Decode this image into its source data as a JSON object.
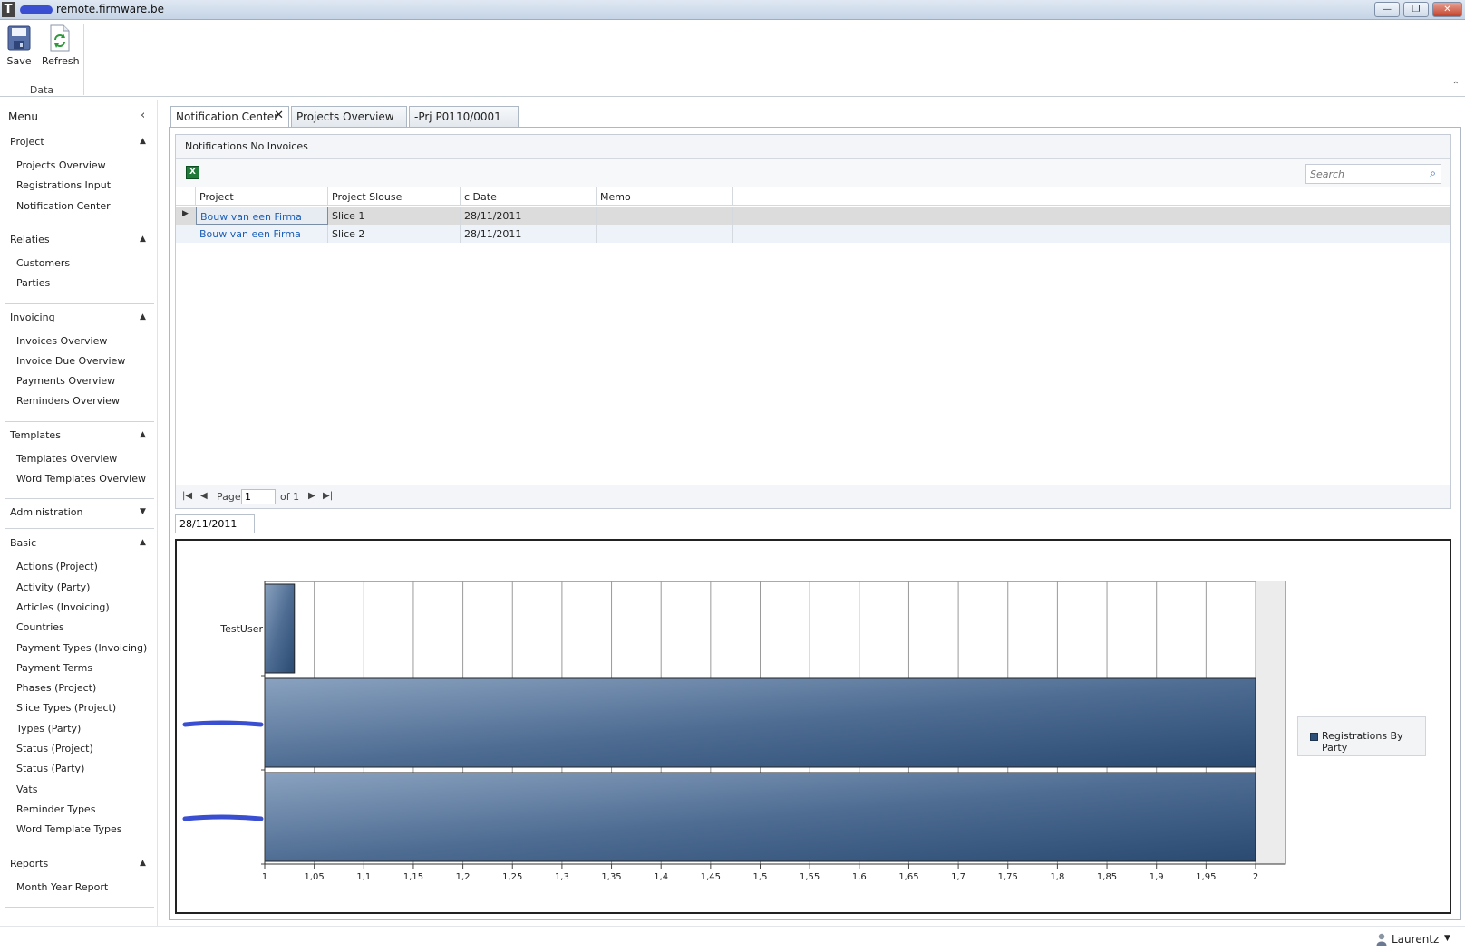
{
  "window": {
    "title": "remote.firmware.be",
    "minimize": "—",
    "maximize": "❐",
    "close": "✕"
  },
  "ribbon": {
    "save_label": "Save",
    "refresh_label": "Refresh",
    "group_label": "Data",
    "collapse": "⌃"
  },
  "sidebar": {
    "title": "Menu",
    "collapse": "‹",
    "sections": [
      {
        "title": "Project",
        "expanded": true,
        "items": [
          "Projects Overview",
          "Registrations Input",
          "Notification Center"
        ]
      },
      {
        "title": "Relaties",
        "expanded": true,
        "items": [
          "Customers",
          "Parties"
        ]
      },
      {
        "title": "Invoicing",
        "expanded": true,
        "items": [
          "Invoices Overview",
          "Invoice Due Overview",
          "Payments Overview",
          "Reminders Overview"
        ]
      },
      {
        "title": "Templates",
        "expanded": true,
        "items": [
          "Templates Overview",
          "Word Templates Overview"
        ]
      },
      {
        "title": "Administration",
        "expanded": false,
        "items": []
      },
      {
        "title": "Basic",
        "expanded": true,
        "items": [
          "Actions (Project)",
          "Activity (Party)",
          "Articles (Invoicing)",
          "Countries",
          "Payment Types (Invoicing)",
          "Payment Terms",
          "Phases (Project)",
          "Slice Types (Project)",
          "Types (Party)",
          "Status (Project)",
          "Status (Party)",
          "Vats",
          "Reminder Types",
          "Word Template Types"
        ]
      },
      {
        "title": "Reports",
        "expanded": true,
        "items": [
          "Month Year Report"
        ]
      }
    ]
  },
  "tabs": [
    {
      "label": "Notification Center",
      "active": true
    },
    {
      "label": "Projects Overview",
      "active": false
    },
    {
      "label": "-Prj P0110/0001",
      "active": false
    }
  ],
  "grid": {
    "caption": "Notifications No Invoices",
    "search_placeholder": "Search",
    "columns": [
      "Project",
      "Project Slouse",
      "c Date",
      "Memo"
    ],
    "rows": [
      [
        "Bouw van een Firma",
        "Slice 1",
        "28/11/2011",
        ""
      ],
      [
        "Bouw van een Firma",
        "Slice 2",
        "28/11/2011",
        ""
      ]
    ],
    "pager": {
      "page_label": "Page",
      "page_value": "1",
      "of_label": "of 1"
    }
  },
  "date_filter": "28/11/2011",
  "chart_data": {
    "type": "bar",
    "orientation": "horizontal",
    "categories": [
      "TestUser",
      "[redacted]",
      "[redacted]"
    ],
    "series": [
      {
        "name": "Registrations By Party",
        "values": [
          1,
          2,
          2
        ]
      }
    ],
    "xlim": [
      1,
      2
    ],
    "x_ticks": [
      "1",
      "1,05",
      "1,1",
      "1,15",
      "1,2",
      "1,25",
      "1,3",
      "1,35",
      "1,4",
      "1,45",
      "1,5",
      "1,55",
      "1,6",
      "1,65",
      "1,7",
      "1,75",
      "1,8",
      "1,85",
      "1,9",
      "1,95",
      "2"
    ],
    "grid": true,
    "legend": "right",
    "color": "#2e4f78"
  },
  "status": {
    "user": "Laurentz"
  }
}
